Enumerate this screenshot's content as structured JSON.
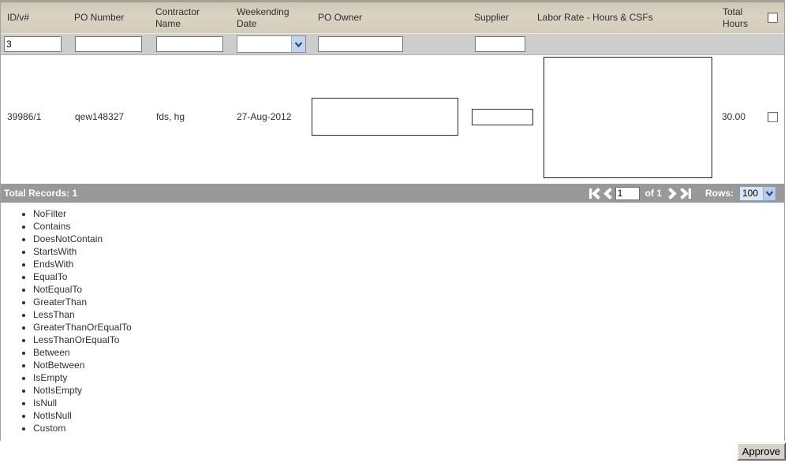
{
  "grid": {
    "columns": [
      {
        "label": "ID/v#"
      },
      {
        "label": "PO Number"
      },
      {
        "label": "Contractor Name"
      },
      {
        "label": "Weekending Date"
      },
      {
        "label": "PO Owner"
      },
      {
        "label": "Supplier"
      },
      {
        "label": "Labor Rate - Hours & CSFs"
      },
      {
        "label": "Total Hours"
      }
    ],
    "header_select_all_checked": false,
    "filters": {
      "id_value": "3",
      "po_number_value": "",
      "contractor_name_value": "",
      "weekending_date_value": "",
      "po_owner_value": "",
      "supplier_value": ""
    },
    "row": {
      "id": "39986/1",
      "po_number": "qew148327",
      "contractor_name": "fds, hg",
      "weekending_date": "27-Aug-2012",
      "po_owner_value": "",
      "supplier_value": "",
      "labor_rate_value": "",
      "total_hours": "30.00",
      "selected": false
    }
  },
  "pager": {
    "total_records_label": "Total Records: 1",
    "page_value": "1",
    "of_label": "of 1",
    "rows_label": "Rows:",
    "rows_value": "100"
  },
  "filter_options": [
    "NoFilter",
    "Contains",
    "DoesNotContain",
    "StartsWith",
    "EndsWith",
    "EqualTo",
    "NotEqualTo",
    "GreaterThan",
    "LessThan",
    "GreaterThanOrEqualTo",
    "LessThanOrEqualTo",
    "Between",
    "NotBetween",
    "IsEmpty",
    "NotIsEmpty",
    "IsNull",
    "NotIsNull",
    "Custom"
  ],
  "footer": {
    "approve_label": "Approve"
  },
  "colors": {
    "header_bg": "#d6cfbf",
    "filter_row_bg": "#cdcdcd",
    "pager_bg": "#999999",
    "combo_arrow_bg": "#c3d5ee",
    "combo_arrow_glyph": "#2b4a77",
    "rows_combo_bg": "#dbe6f4",
    "button_face": "#d6d2c9"
  }
}
